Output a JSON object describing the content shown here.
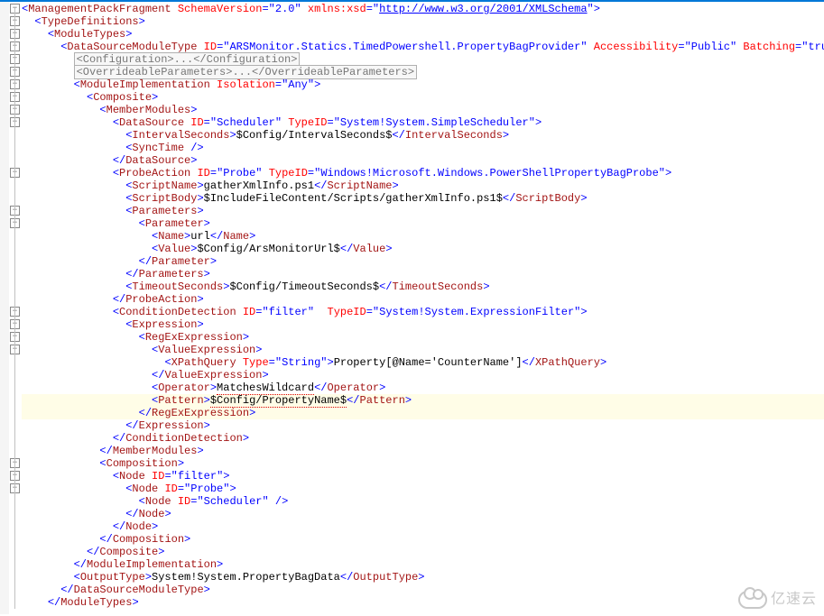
{
  "indent_unit": "  ",
  "lines": [
    {
      "i": 0,
      "kind": "tag",
      "name": "ManagementPackFragment",
      "attrs": [
        {
          "n": "SchemaVersion",
          "v": "2.0"
        },
        {
          "n": "xmlns:xsd",
          "v": "http://www.w3.org/2001/XMLSchema",
          "link": true
        }
      ],
      "open": true,
      "fold": "minus"
    },
    {
      "i": 1,
      "kind": "tag",
      "name": "TypeDefinitions",
      "open": true,
      "fold": "minus"
    },
    {
      "i": 2,
      "kind": "tag",
      "name": "ModuleTypes",
      "open": true,
      "fold": "minus"
    },
    {
      "i": 3,
      "kind": "tag",
      "name": "DataSourceModuleType",
      "attrs": [
        {
          "n": "ID",
          "v": "ARSMonitor.Statics.TimedPowershell.PropertyBagProvider"
        },
        {
          "n": "Accessibility",
          "v": "Public"
        },
        {
          "n": "Batching",
          "v": "true"
        }
      ],
      "open": true,
      "fold": "minus"
    },
    {
      "i": 4,
      "kind": "collapsed",
      "open": "Configuration",
      "close": "Configuration",
      "fold": "plus"
    },
    {
      "i": 4,
      "kind": "collapsed",
      "open": "OverrideableParameters",
      "close": "OverrideableParameters",
      "fold": "plus"
    },
    {
      "i": 4,
      "kind": "tag",
      "name": "ModuleImplementation",
      "attrs": [
        {
          "n": "Isolation",
          "v": "Any"
        }
      ],
      "open": true,
      "fold": "minus"
    },
    {
      "i": 5,
      "kind": "tag",
      "name": "Composite",
      "open": true,
      "fold": "minus"
    },
    {
      "i": 6,
      "kind": "tag",
      "name": "MemberModules",
      "open": true,
      "fold": "minus"
    },
    {
      "i": 7,
      "kind": "tag",
      "name": "DataSource",
      "attrs": [
        {
          "n": "ID",
          "v": "Scheduler"
        },
        {
          "n": "TypeID",
          "v": "System!System.SimpleScheduler"
        }
      ],
      "open": true,
      "fold": "minus"
    },
    {
      "i": 8,
      "kind": "leaf",
      "name": "IntervalSeconds",
      "text": "$Config/IntervalSeconds$"
    },
    {
      "i": 8,
      "kind": "self",
      "name": "SyncTime"
    },
    {
      "i": 7,
      "kind": "close",
      "name": "DataSource"
    },
    {
      "i": 7,
      "kind": "tag",
      "name": "ProbeAction",
      "attrs": [
        {
          "n": "ID",
          "v": "Probe"
        },
        {
          "n": "TypeID",
          "v": "Windows!Microsoft.Windows.PowerShellPropertyBagProbe"
        }
      ],
      "open": true,
      "fold": "minus"
    },
    {
      "i": 8,
      "kind": "leaf",
      "name": "ScriptName",
      "text": "gatherXmlInfo.ps1"
    },
    {
      "i": 8,
      "kind": "leaf",
      "name": "ScriptBody",
      "text": "$IncludeFileContent/Scripts/gatherXmlInfo.ps1$"
    },
    {
      "i": 8,
      "kind": "tag",
      "name": "Parameters",
      "open": true,
      "fold": "minus"
    },
    {
      "i": 9,
      "kind": "tag",
      "name": "Parameter",
      "open": true,
      "fold": "minus"
    },
    {
      "i": 10,
      "kind": "leaf",
      "name": "Name",
      "text": "url"
    },
    {
      "i": 10,
      "kind": "leaf",
      "name": "Value",
      "text": "$Config/ArsMonitorUrl$"
    },
    {
      "i": 9,
      "kind": "close",
      "name": "Parameter"
    },
    {
      "i": 8,
      "kind": "close",
      "name": "Parameters"
    },
    {
      "i": 8,
      "kind": "leaf",
      "name": "TimeoutSeconds",
      "text": "$Config/TimeoutSeconds$"
    },
    {
      "i": 7,
      "kind": "close",
      "name": "ProbeAction"
    },
    {
      "i": 7,
      "kind": "tag",
      "name": "ConditionDetection",
      "attrs": [
        {
          "n": "ID",
          "v": "filter"
        },
        {
          "n": "TypeID",
          "v": "System!System.ExpressionFilter",
          "gap": true
        }
      ],
      "open": true,
      "fold": "minus"
    },
    {
      "i": 8,
      "kind": "tag",
      "name": "Expression",
      "open": true,
      "fold": "minus"
    },
    {
      "i": 9,
      "kind": "tag",
      "name": "RegExExpression",
      "open": true,
      "fold": "minus"
    },
    {
      "i": 10,
      "kind": "tag",
      "name": "ValueExpression",
      "open": true,
      "fold": "minus"
    },
    {
      "i": 11,
      "kind": "leaf",
      "name": "XPathQuery",
      "attrs": [
        {
          "n": "Type",
          "v": "String"
        }
      ],
      "text": "Property[@Name='CounterName']"
    },
    {
      "i": 10,
      "kind": "close",
      "name": "ValueExpression"
    },
    {
      "i": 10,
      "kind": "leaf",
      "name": "Operator",
      "text": "MatchesWildcard",
      "squiggle": true
    },
    {
      "i": 10,
      "kind": "leaf",
      "name": "Pattern",
      "text": "$Config/PropertyName$",
      "squiggle": true,
      "hl": true
    },
    {
      "i": 9,
      "kind": "close",
      "name": "RegExExpression",
      "hl": true
    },
    {
      "i": 8,
      "kind": "close",
      "name": "Expression"
    },
    {
      "i": 7,
      "kind": "close",
      "name": "ConditionDetection"
    },
    {
      "i": 6,
      "kind": "close",
      "name": "MemberModules"
    },
    {
      "i": 6,
      "kind": "tag",
      "name": "Composition",
      "open": true,
      "fold": "minus"
    },
    {
      "i": 7,
      "kind": "tag",
      "name": "Node",
      "attrs": [
        {
          "n": "ID",
          "v": "filter"
        }
      ],
      "open": true,
      "fold": "minus"
    },
    {
      "i": 8,
      "kind": "tag",
      "name": "Node",
      "attrs": [
        {
          "n": "ID",
          "v": "Probe"
        }
      ],
      "open": true,
      "fold": "minus"
    },
    {
      "i": 9,
      "kind": "self",
      "name": "Node",
      "attrs": [
        {
          "n": "ID",
          "v": "Scheduler"
        }
      ]
    },
    {
      "i": 8,
      "kind": "close",
      "name": "Node"
    },
    {
      "i": 7,
      "kind": "close",
      "name": "Node"
    },
    {
      "i": 6,
      "kind": "close",
      "name": "Composition"
    },
    {
      "i": 5,
      "kind": "close",
      "name": "Composite"
    },
    {
      "i": 4,
      "kind": "close",
      "name": "ModuleImplementation"
    },
    {
      "i": 4,
      "kind": "leaf",
      "name": "OutputType",
      "text": "System!System.PropertyBagData"
    },
    {
      "i": 3,
      "kind": "close",
      "name": "DataSourceModuleType"
    },
    {
      "i": 2,
      "kind": "close",
      "name": "ModuleTypes"
    }
  ],
  "watermark": "亿速云"
}
